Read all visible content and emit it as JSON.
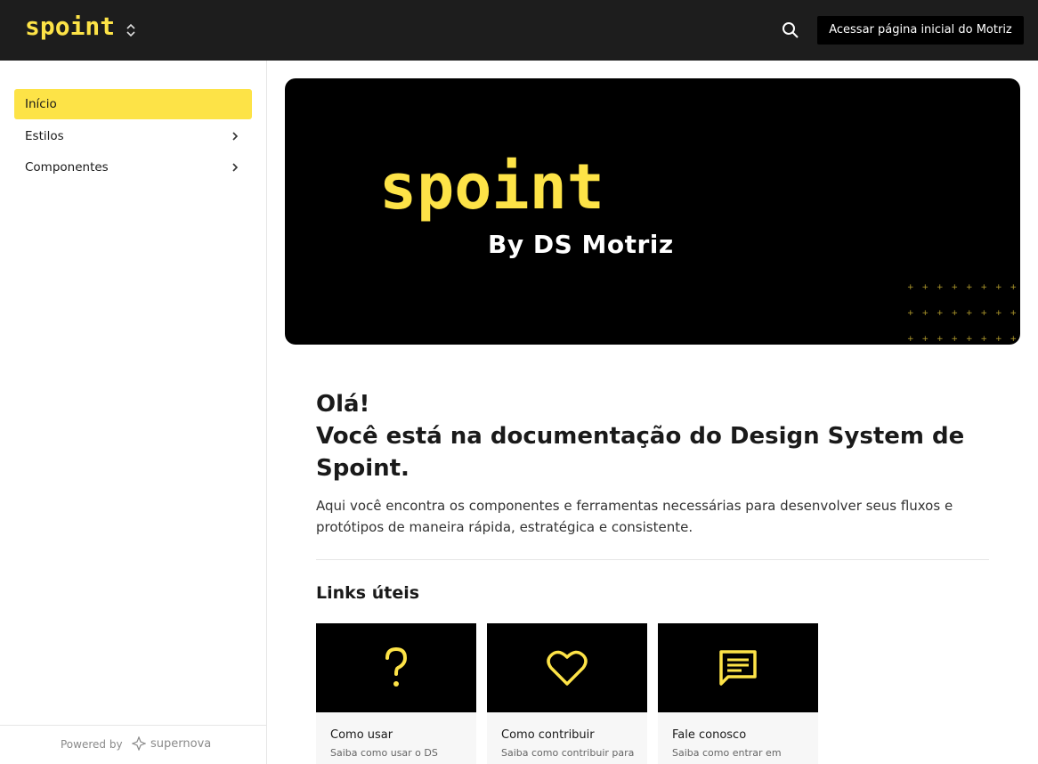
{
  "header": {
    "logo_text": "spoint",
    "cta_label": "Acessar página inicial do Motriz"
  },
  "sidebar": {
    "items": [
      {
        "label": "Início"
      },
      {
        "label": "Estilos"
      },
      {
        "label": "Componentes"
      }
    ],
    "powered_by": "Powered by",
    "brand": "supernova"
  },
  "hero": {
    "logo_text": "spoint",
    "subtitle": "By DS Motriz"
  },
  "content": {
    "greeting": "Olá!",
    "heading": "Você está na documentação do Design System de Spoint.",
    "intro": "Aqui você encontra os componentes e ferramentas necessárias para desenvolver seus fluxos e protótipos de maneira rápida, estratégica e consistente.",
    "links_title": "Links úteis"
  },
  "cards": [
    {
      "title": "Como usar",
      "desc": "Saiba como usar o DS",
      "icon": "question-icon"
    },
    {
      "title": "Como contribuir",
      "desc": "Saiba como contribuir para",
      "icon": "heart-icon"
    },
    {
      "title": "Fale conosco",
      "desc": "Saiba como entrar em",
      "icon": "chat-icon"
    }
  ],
  "colors": {
    "accent": "#fde347",
    "topbar": "#1d1d1d",
    "hero_bg": "#000000"
  }
}
